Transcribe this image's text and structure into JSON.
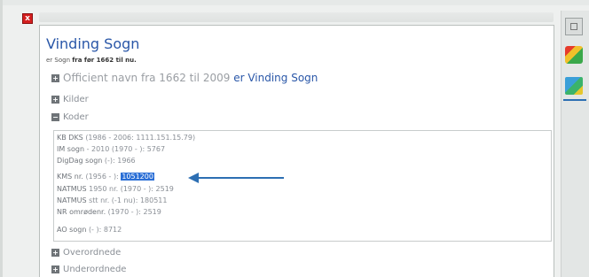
{
  "window": {
    "close_glyph": "x"
  },
  "record": {
    "title": "Vinding Sogn",
    "subtitle_prefix": "er Sogn",
    "subtitle_bold": "fra før 1662 til nu."
  },
  "sections": {
    "official_prefix": "Officient navn fra 1662 til 2009",
    "official_link": "er Vinding Sogn",
    "kilder": "Kilder",
    "koder": "Koder",
    "overordnede": "Overordnede",
    "underordnede": "Underordnede"
  },
  "codes": [
    {
      "key": "KB DKS",
      "value": "(1986 - 2006: 1111.151.15.79)"
    },
    {
      "key": "IM sogn",
      "value": "- 2010 (1970 - ): 5767"
    },
    {
      "key": "DigDag sogn",
      "value": "(-): 1966"
    },
    {
      "key": "KMS nr.",
      "value": "(1956 - ):",
      "highlight": "1051200"
    },
    {
      "key": "NATMUS",
      "value": "1950 nr. (1970 - ): 2519"
    },
    {
      "key": "NATMUS",
      "value": "stt nr. (-1 nu): 180511"
    },
    {
      "key": "NR omrødenr.",
      "value": "(1970 - ): 2519"
    },
    {
      "key": "AO sogn",
      "value": "(- ): 8712"
    }
  ],
  "colors": {
    "link": "#2a57a8",
    "highlight": "#2b6fd6",
    "arrow": "#2d6fb3",
    "close": "#d41f1f"
  },
  "icons": {
    "sidebar": [
      "window-icon",
      "colorful-globe-icon",
      "map-icon"
    ]
  }
}
